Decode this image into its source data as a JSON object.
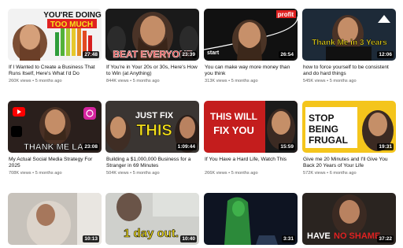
{
  "videos": [
    {
      "title": "If I Wanted to Create a Business That Runs Itself, Here's What I'd Do",
      "views": "260K views",
      "age": "5 months ago",
      "duration": "27:48",
      "overlay": "YOU'RE DOING",
      "overlay2": "TOO MUCH"
    },
    {
      "title": "If You're in Your 20s or 30s, Here's How to Win (at Anything)",
      "views": "844K views",
      "age": "5 months ago",
      "duration": "23:39",
      "overlay": "BEAT EVERYONE"
    },
    {
      "title": "You can make way more money than you think",
      "views": "313K views",
      "age": "5 months ago",
      "duration": "26:54",
      "overlay": "profit",
      "overlay2": "start"
    },
    {
      "title": "how to force yourself to be consistent and do hard things",
      "views": "545K views",
      "age": "5 months ago",
      "duration": "12:06",
      "overlay": "Thank Me in 3 Years"
    },
    {
      "title": "My Actual Social Media Strategy For 2025",
      "views": "708K views",
      "age": "5 months ago",
      "duration": "23:08",
      "overlay": "THANK ME LA"
    },
    {
      "title": "Building a $1,000,000 Business for a Stranger in 69 Minutes",
      "views": "504K views",
      "age": "5 months ago",
      "duration": "1:09:44",
      "overlay": "JUST FIX",
      "overlay2": "THIS"
    },
    {
      "title": "If You Have a Hard Life, Watch This",
      "views": "266K views",
      "age": "5 months ago",
      "duration": "15:59",
      "overlay": "THIS WILL",
      "overlay2": "FIX YOU"
    },
    {
      "title": "Give me 20 Minutes and I'll Give You Back 20 Years of Your Life",
      "views": "572K views",
      "age": "6 months ago",
      "duration": "19:31",
      "overlay": "STOP",
      "overlay2": "BEING",
      "overlay3": "FRUGAL"
    },
    {
      "title": "",
      "views": "",
      "age": "",
      "duration": "10:13"
    },
    {
      "title": "",
      "views": "",
      "age": "",
      "duration": "10:40",
      "overlay": "1 day out."
    },
    {
      "title": "",
      "views": "",
      "age": "",
      "duration": "3:31"
    },
    {
      "title": "",
      "views": "",
      "age": "",
      "duration": "37:22",
      "overlay": "HAVE",
      "overlay2": "NO SHAME"
    }
  ],
  "separator": "•",
  "colors": {
    "accent_yellow": "#f7e21b",
    "accent_red": "#e02121",
    "text": "#0f0f0f",
    "meta": "#606060"
  }
}
